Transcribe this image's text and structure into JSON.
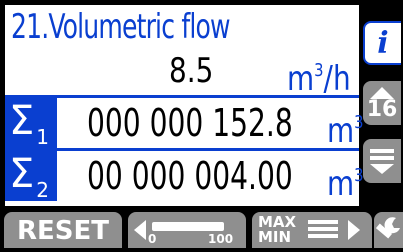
{
  "screen": {
    "title": "21.Volumetric flow",
    "flow_rate": "8.5",
    "flow_rate_unit": "m",
    "flow_rate_unit_sup": "3",
    "flow_rate_unit_suffix": "/h",
    "totals": [
      {
        "symbol": "Σ",
        "index": "1",
        "value": "000 000 152.8",
        "unit": "m",
        "unit_sup": "3"
      },
      {
        "symbol": "Σ",
        "index": "2",
        "value": "00 000 004.00",
        "unit": "m",
        "unit_sup": "3"
      }
    ]
  },
  "side": {
    "info_label": "i",
    "scroll_up_label": "16"
  },
  "bottom": {
    "reset_label": "RESET",
    "slider_min": "0",
    "slider_max": "100",
    "maxmin_top": "MAX",
    "maxmin_bottom": "MIN"
  },
  "colors": {
    "accent": "#0a3fd0",
    "button": "#8f8f8f",
    "background": "#000000"
  }
}
